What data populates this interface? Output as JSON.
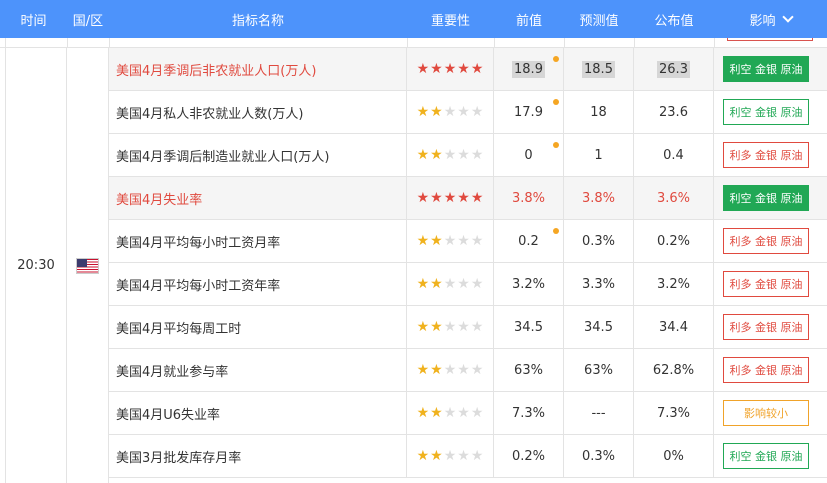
{
  "header": {
    "time": "时间",
    "country": "国/区",
    "name": "指标名称",
    "importance": "重要性",
    "previous": "前值",
    "forecast": "预测值",
    "actual": "公布值",
    "effect": "影响"
  },
  "group": {
    "time": "20:30",
    "country_flag": "us-flag"
  },
  "colors": {
    "header_bg": "#4d93fb",
    "red": "#e04a3f",
    "green": "#21a855",
    "orange": "#f0a32a",
    "star_red": "#e04a3f",
    "star_gold": "#f0b21e"
  },
  "rows": [
    {
      "name": "美国4月季调后非农就业人口(万人)",
      "stars": 5,
      "previous": "18.9",
      "forecast": "18.5",
      "actual": "26.3",
      "effect": "利空 金银 原油",
      "effect_style": "solid-green",
      "highlight": true,
      "red_text": true,
      "dot": true,
      "gray": true,
      "red_values": false
    },
    {
      "name": "美国4月私人非农就业人数(万人)",
      "stars": 2,
      "previous": "17.9",
      "forecast": "18",
      "actual": "23.6",
      "effect": "利空 金银 原油",
      "effect_style": "out-green",
      "highlight": false,
      "red_text": false,
      "dot": true,
      "gray": false,
      "red_values": false
    },
    {
      "name": "美国4月季调后制造业就业人口(万人)",
      "stars": 2,
      "previous": "0",
      "forecast": "1",
      "actual": "0.4",
      "effect": "利多 金银 原油",
      "effect_style": "out-red",
      "highlight": false,
      "red_text": false,
      "dot": true,
      "gray": false,
      "red_values": false
    },
    {
      "name": "美国4月失业率",
      "stars": 5,
      "previous": "3.8%",
      "forecast": "3.8%",
      "actual": "3.6%",
      "effect": "利空 金银 原油",
      "effect_style": "solid-green",
      "highlight": true,
      "red_text": true,
      "dot": false,
      "gray": false,
      "red_values": true
    },
    {
      "name": "美国4月平均每小时工资月率",
      "stars": 2,
      "previous": "0.2",
      "forecast": "0.3%",
      "actual": "0.2%",
      "effect": "利多 金银 原油",
      "effect_style": "out-red",
      "highlight": false,
      "red_text": false,
      "dot": true,
      "gray": false,
      "red_values": false
    },
    {
      "name": "美国4月平均每小时工资年率",
      "stars": 2,
      "previous": "3.2%",
      "forecast": "3.3%",
      "actual": "3.2%",
      "effect": "利多 金银 原油",
      "effect_style": "out-red",
      "highlight": false,
      "red_text": false,
      "dot": false,
      "gray": false,
      "red_values": false
    },
    {
      "name": "美国4月平均每周工时",
      "stars": 2,
      "previous": "34.5",
      "forecast": "34.5",
      "actual": "34.4",
      "effect": "利多 金银 原油",
      "effect_style": "out-red",
      "highlight": false,
      "red_text": false,
      "dot": false,
      "gray": false,
      "red_values": false
    },
    {
      "name": "美国4月就业参与率",
      "stars": 2,
      "previous": "63%",
      "forecast": "63%",
      "actual": "62.8%",
      "effect": "利多 金银 原油",
      "effect_style": "out-red",
      "highlight": false,
      "red_text": false,
      "dot": false,
      "gray": false,
      "red_values": false
    },
    {
      "name": "美国4月U6失业率",
      "stars": 2,
      "previous": "7.3%",
      "forecast": "---",
      "actual": "7.3%",
      "effect": "影响较小",
      "effect_style": "out-orange",
      "highlight": false,
      "red_text": false,
      "dot": false,
      "gray": false,
      "red_values": false
    },
    {
      "name": "美国3月批发库存月率",
      "stars": 2,
      "previous": "0.2%",
      "forecast": "0.3%",
      "actual": "0%",
      "effect": "利空 金银 原油",
      "effect_style": "out-green",
      "highlight": false,
      "red_text": false,
      "dot": false,
      "gray": false,
      "red_values": false
    }
  ]
}
